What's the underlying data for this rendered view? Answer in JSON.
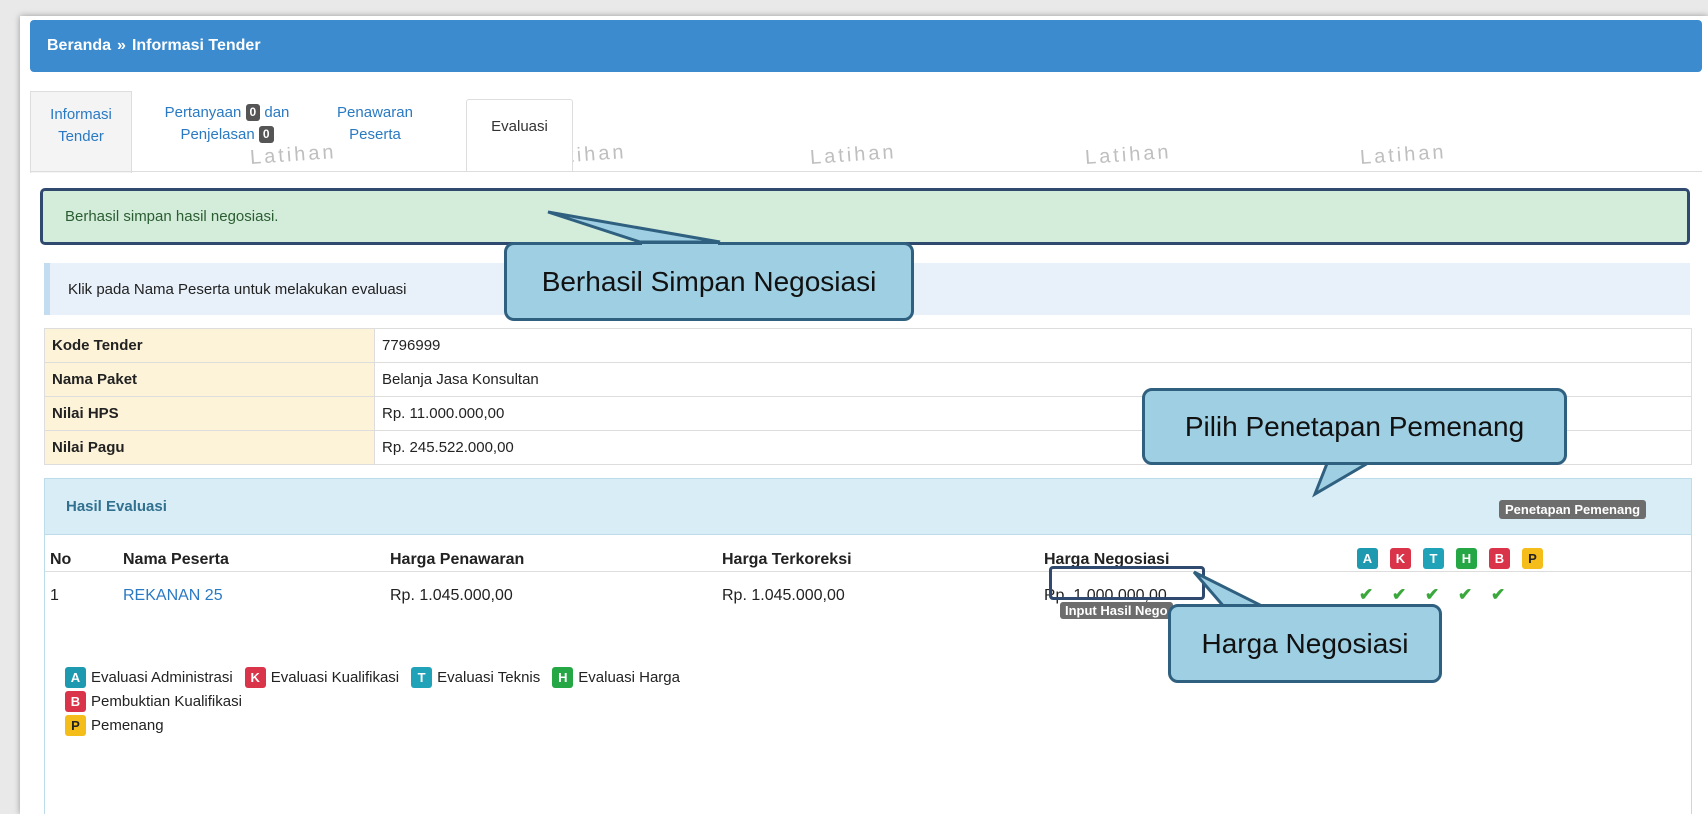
{
  "breadcrumb": {
    "home": "Beranda",
    "separator": "»",
    "current": "Informasi Tender"
  },
  "tabs": {
    "informasi_line1": "Informasi",
    "informasi_line2": "Tender",
    "pertanyaan_line1": "Pertanyaan",
    "pertanyaan_count": "0",
    "pertanyaan_and": "dan",
    "penjelasan_line2": "Penjelasan",
    "penjelasan_count": "0",
    "penawaran_line1": "Penawaran",
    "penawaran_line2": "Peserta",
    "evaluasi": "Evaluasi"
  },
  "watermark": "Latihan",
  "alert": "Berhasil simpan hasil negosiasi.",
  "info": "Klik pada Nama Peserta untuk melakukan evaluasi",
  "details": [
    {
      "label": "Kode Tender",
      "value": "7796999"
    },
    {
      "label": "Nama Paket",
      "value": "Belanja Jasa Konsultan"
    },
    {
      "label": "Nilai HPS",
      "value": "Rp. 11.000.000,00"
    },
    {
      "label": "Nilai Pagu",
      "value": "Rp. 245.522.000,00"
    }
  ],
  "evaluation": {
    "title": "Hasil Evaluasi",
    "penetapan_button": "Penetapan Pemenang",
    "columns": {
      "no": "No",
      "nama": "Nama Peserta",
      "penawaran": "Harga Penawaran",
      "terkoreksi": "Harga Terkoreksi",
      "negosiasi": "Harga Negosiasi"
    },
    "letters": [
      "A",
      "K",
      "T",
      "H",
      "B",
      "P"
    ],
    "rows": [
      {
        "no": "1",
        "nama": "REKANAN 25",
        "penawaran": "Rp. 1.045.000,00",
        "terkoreksi": "Rp. 1.045.000,00",
        "negosiasi": "Rp. 1.000.000,00",
        "checks": [
          "✔",
          "✔",
          "✔",
          "✔",
          "✔"
        ]
      }
    ],
    "input_nego_button": "Input Hasil Nego",
    "legend": {
      "A": "Evaluasi Administrasi",
      "K": "Evaluasi Kualifikasi",
      "T": "Evaluasi Teknis",
      "H": "Evaluasi Harga",
      "B": "Pembuktian Kualifikasi",
      "P": "Pemenang"
    }
  },
  "callouts": {
    "berhasil": "Berhasil Simpan Negosiasi",
    "pilih": "Pilih Penetapan Pemenang",
    "harga": "Harga Negosiasi"
  },
  "colors": {
    "header_blue": "#3b8bce",
    "callout_fill": "#9fcfe2",
    "callout_border": "#2f6080",
    "highlight_border": "#2f4a6e",
    "check_green": "#3aa83c"
  }
}
